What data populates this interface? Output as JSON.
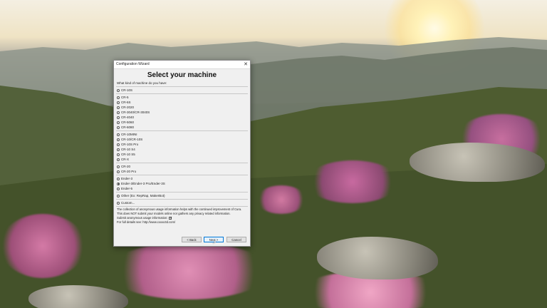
{
  "window": {
    "title": "Configuration Wizard",
    "close_glyph": "✕"
  },
  "page": {
    "heading": "Select your machine",
    "question": "What kind of machine do you have:"
  },
  "groups": [
    {
      "options": [
        {
          "label": "CR-10S",
          "selected": false
        }
      ]
    },
    {
      "options": [
        {
          "label": "CR-5",
          "selected": false
        },
        {
          "label": "CR-6S",
          "selected": false
        },
        {
          "label": "CR-2020",
          "selected": false
        },
        {
          "label": "CR-3040/CR-3040S",
          "selected": false
        },
        {
          "label": "CR-4040",
          "selected": false
        },
        {
          "label": "CR-5060",
          "selected": false
        },
        {
          "label": "CR-6080",
          "selected": false
        }
      ]
    },
    {
      "options": [
        {
          "label": "CR-10MINI",
          "selected": false
        },
        {
          "label": "CR-10/CR-10S",
          "selected": false
        },
        {
          "label": "CR-10S Pro",
          "selected": false
        },
        {
          "label": "CR-10 S4",
          "selected": false
        },
        {
          "label": "CR-10 S5",
          "selected": false
        },
        {
          "label": "CR-X",
          "selected": false
        }
      ]
    },
    {
      "options": [
        {
          "label": "CR-20",
          "selected": false
        },
        {
          "label": "CR-20 Pro",
          "selected": false
        }
      ]
    },
    {
      "options": [
        {
          "label": "Ender-3",
          "selected": false
        },
        {
          "label": "Ender-3/Ender-3 Pro/Ender-3S",
          "selected": true
        },
        {
          "label": "Ender-5",
          "selected": false
        }
      ]
    },
    {
      "options": [
        {
          "label": "Other (Ex: RepRap, MakerBot)",
          "selected": false
        }
      ]
    },
    {
      "options": [
        {
          "label": "Custom...",
          "selected": false
        }
      ]
    }
  ],
  "usage": {
    "line1": "The collection of anonymous usage information helps with the continued improvement of Cura.",
    "line2": "This does NOT submit your models online nor gathers any privacy related information.",
    "submit_label": "Submit anonymous usage information:",
    "details": "For full details see: http://www.cxxxx3d.com/"
  },
  "buttons": {
    "back": "< Back",
    "next": "Next >",
    "cancel": "Cancel"
  },
  "colors": {
    "accent": "#0078d7",
    "dialog_bg": "#f0f0f0"
  }
}
